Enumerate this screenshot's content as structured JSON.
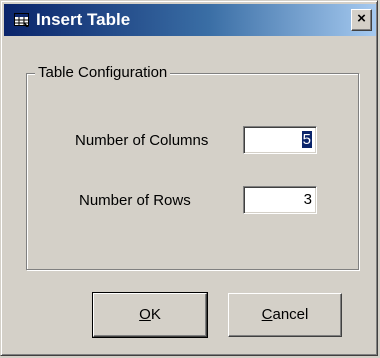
{
  "window": {
    "title": "Insert Table",
    "close_glyph": "×",
    "title_icon": "table-window-icon"
  },
  "group": {
    "label": "Table Configuration"
  },
  "fields": {
    "columns_label": "Number of Columns",
    "columns_value": "5",
    "rows_label": "Number of Rows",
    "rows_value": "3"
  },
  "buttons": {
    "ok_mnemonic": "O",
    "ok_rest": "K",
    "cancel_mnemonic": "C",
    "cancel_rest": "ancel"
  },
  "colors": {
    "title_active": "#0a246a",
    "title_gradient_end": "#a6caf0",
    "face": "#d4d0c8",
    "selection": "#0a246a"
  }
}
